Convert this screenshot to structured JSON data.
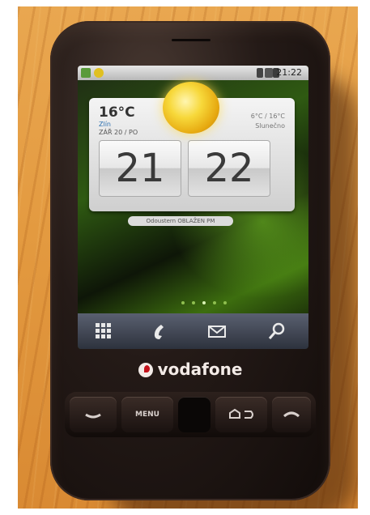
{
  "image": {
    "description_label": "vodafone phone on wooden table"
  },
  "phone": {
    "brand": "vodafone",
    "status_time": "21:22",
    "weather": {
      "temperature": "16°C",
      "city": "Zlín",
      "date": "ZÁŘ 20 / PO",
      "range": "6°C / 16°C",
      "condition": "Slunečno"
    },
    "clock": {
      "hours": "21",
      "minutes": "22"
    },
    "alarm": "Odoustern OBLAŽEN PM",
    "keys": {
      "menu": "MENU"
    },
    "colors": {
      "brand_red": "#c4121b",
      "wallpaper_green": "#3d6e0f"
    }
  }
}
